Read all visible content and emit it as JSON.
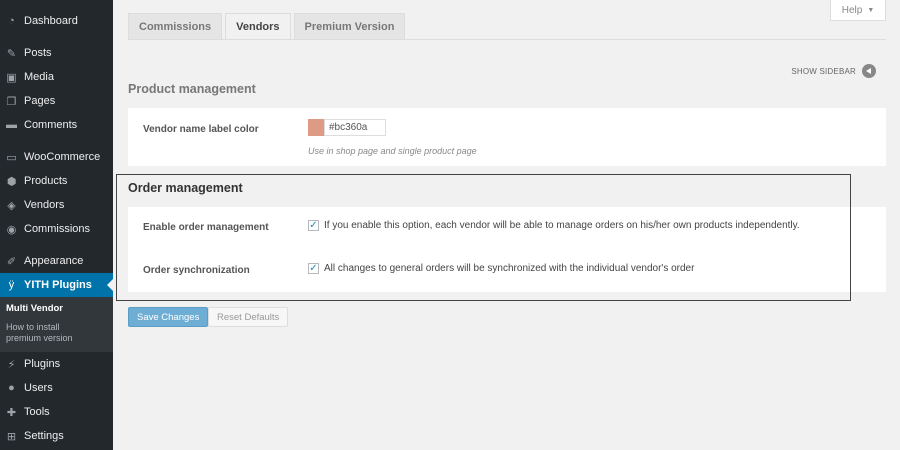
{
  "sidebar": {
    "items": [
      {
        "label": "Dashboard",
        "icon": "dashboard-icon",
        "glyph": "◔"
      },
      {
        "label": "Posts",
        "icon": "pushpin-icon",
        "glyph": "✎"
      },
      {
        "label": "Media",
        "icon": "media-icon",
        "glyph": "▣"
      },
      {
        "label": "Pages",
        "icon": "pages-icon",
        "glyph": "❐"
      },
      {
        "label": "Comments",
        "icon": "comment-icon",
        "glyph": "▬"
      },
      {
        "label": "WooCommerce",
        "icon": "woocommerce-icon",
        "glyph": "▭"
      },
      {
        "label": "Products",
        "icon": "box-icon",
        "glyph": "⬢"
      },
      {
        "label": "Vendors",
        "icon": "vendor-icon",
        "glyph": "◈"
      },
      {
        "label": "Commissions",
        "icon": "commissions-icon",
        "glyph": "◉"
      },
      {
        "label": "Appearance",
        "icon": "brush-icon",
        "glyph": "✐"
      },
      {
        "label": "YITH Plugins",
        "icon": "yith-icon",
        "glyph": "ÿ"
      },
      {
        "label": "Plugins",
        "icon": "plugin-icon",
        "glyph": "⚡"
      },
      {
        "label": "Users",
        "icon": "user-icon",
        "glyph": "●"
      },
      {
        "label": "Tools",
        "icon": "wrench-icon",
        "glyph": "✚"
      },
      {
        "label": "Settings",
        "icon": "settings-icon",
        "glyph": "⊞"
      }
    ],
    "submenu": {
      "current": "Multi Vendor",
      "item": "How to install premium version"
    }
  },
  "tabs": [
    {
      "label": "Commissions",
      "active": false
    },
    {
      "label": "Vendors",
      "active": true
    },
    {
      "label": "Premium Version",
      "active": false
    }
  ],
  "help": {
    "label": "Help",
    "caret": "▼"
  },
  "show_sidebar": {
    "label": "SHOW SIDEBAR"
  },
  "product_management": {
    "title": "Product management",
    "vendor_label_color": {
      "label": "Vendor name label color",
      "value": "#bc360a",
      "swatch_color": "#dd9a84",
      "help": "Use in shop page and single product page"
    }
  },
  "order_management": {
    "title": "Order management",
    "enable": {
      "label": "Enable order management",
      "checked": true,
      "description": "If you enable this option, each vendor will be able to manage orders on his/her own products independently."
    },
    "sync": {
      "label": "Order synchronization",
      "checked": true,
      "description": "All changes to general orders will be synchronized with the individual vendor's order"
    }
  },
  "actions": {
    "save": "Save Changes",
    "reset": "Reset Defaults"
  },
  "colors": {
    "sidebar_bg": "#23282d",
    "active_menu": "#0073aa",
    "submenu_bg": "#32373c",
    "primary_button": "#6eaed5"
  }
}
